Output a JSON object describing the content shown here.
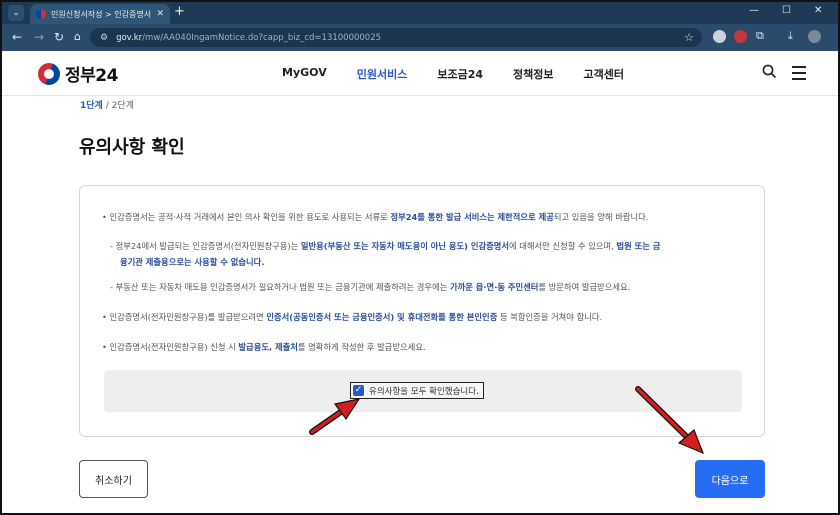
{
  "browser": {
    "tab_title": "민원신청서작성 > 인감증명서",
    "tab_close": "✕",
    "new_tab": "+",
    "url_host": "gov.kr",
    "url_path": "/mw/AA040IngamNotice.do?capp_biz_cd=13100000025",
    "window_controls": [
      "—",
      "☐",
      "✕"
    ]
  },
  "site": {
    "logo_text": "정부24",
    "nav": [
      {
        "label": "MyGOV",
        "active": false
      },
      {
        "label": "민원서비스",
        "active": true
      },
      {
        "label": "보조금24",
        "active": false
      },
      {
        "label": "정책정보",
        "active": false
      },
      {
        "label": "고객센터",
        "active": false
      }
    ]
  },
  "steps": {
    "current": "1단계",
    "separator": "/",
    "next": "2단계"
  },
  "page_title": "유의사항 확인",
  "notices": {
    "n1": {
      "pre": "• 인감증명서는 공적·사적 거래에서 본인 의사 확인을 위한 용도로 사용되는 서류로 ",
      "bold": "정부24를 통한 발급 서비스는 제한적으로 제공",
      "post": "되고 있음을 양해 바랍니다."
    },
    "n2": {
      "pre": "- 정부24에서 발급되는 인감증명서(전자민원창구용)는 ",
      "bold1": "일반용(부동산 또는 자동차 매도용이 아닌 용도) 인감증명서",
      "mid": "에 대해서만 신청할 수 있으며, ",
      "bold2": "법원 또는 금",
      "bold3": "융기관 제출용으로는 사용할 수 없습니다."
    },
    "n3": {
      "pre": "- 부동산 또는 자동차 매도용 인감증명서가 필요하거나 법원 또는 금융기관에 제출하려는 경우에는 ",
      "bold": "가까운 읍·면·동 주민센터",
      "post": "를 방문하여 발급받으세요."
    },
    "n4": {
      "pre": "• 인감증명서(전자민원창구용)를 발급받으려면 ",
      "bold": "인증서(공동인증서 또는 금융인증서) 및 휴대전화를 통한 본인인증",
      "post": " 등 복합인증을 거쳐야 합니다."
    },
    "n5": {
      "pre": "• 인감증명서(전자민원창구용) 신청 시 ",
      "bold": "발급용도, 제출처",
      "post": "를 명확하게 작성한 후 발급받으세요."
    }
  },
  "confirm": {
    "label": "유의사항을 모두 확인했습니다.",
    "checked": true
  },
  "buttons": {
    "cancel": "취소하기",
    "next": "다음으로"
  },
  "colors": {
    "accent": "#256ef4",
    "emphasis": "#2b4d9a",
    "annotation_arrow": "#d11f1f"
  }
}
